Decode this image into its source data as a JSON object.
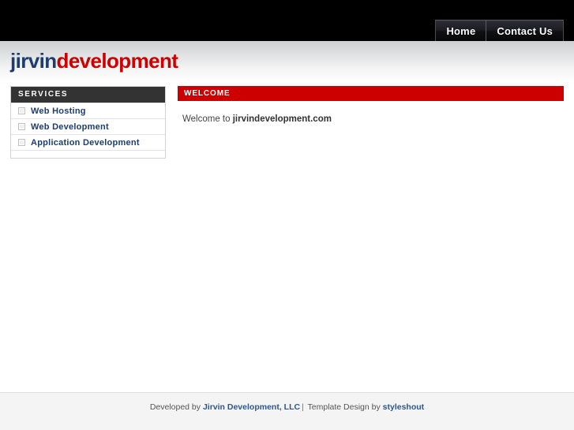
{
  "nav": {
    "items": [
      {
        "label": "Home",
        "name": "nav-item-home"
      },
      {
        "label": "Contact Us",
        "name": "nav-item-contact-us"
      }
    ]
  },
  "logo": {
    "part1": "jirvin",
    "part2": "development",
    "part1_color": "#1c3d6e",
    "part2_color": "#cc0000"
  },
  "sidebar": {
    "title": "SERVICES",
    "items": [
      {
        "label": "Web Hosting"
      },
      {
        "label": "Web Development"
      },
      {
        "label": "Application Development"
      }
    ]
  },
  "main": {
    "title": "WELCOME",
    "body_prefix": "Welcome to ",
    "body_strong": "jirvindevelopment.com"
  },
  "footer": {
    "prefix": "Developed by ",
    "link1": "Jirvin Development, LLC",
    "separator": "|",
    "middle": " Template Design by ",
    "link2": "styleshout"
  },
  "colors": {
    "accent_red": "#cc0000",
    "brand_blue": "#1c3d6e",
    "topbar_black": "#000000",
    "panel_dark": "#333333",
    "link_blue": "#2b5693"
  }
}
